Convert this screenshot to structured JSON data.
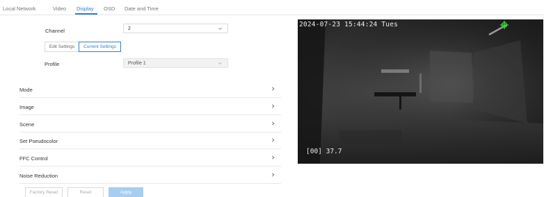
{
  "tabs": [
    {
      "label": "Local Network",
      "active": false
    },
    {
      "label": "Video",
      "active": false
    },
    {
      "label": "Display",
      "active": true
    },
    {
      "label": "OSD",
      "active": false
    },
    {
      "label": "Date and Time",
      "active": false
    }
  ],
  "channel": {
    "label": "Channel",
    "value": "2"
  },
  "settings_toggle": {
    "edit_label": "Edit Settings",
    "current_label": "Current Settings",
    "selected": "Current Settings"
  },
  "profile": {
    "label": "Profile",
    "value": "Profile 1",
    "disabled": true
  },
  "sections": [
    {
      "label": "Mode"
    },
    {
      "label": "Image"
    },
    {
      "label": "Scene"
    },
    {
      "label": "Set Pseudocolor"
    },
    {
      "label": "FFC Control"
    },
    {
      "label": "Noise Reduction"
    }
  ],
  "actions": {
    "factory_reset": "Factory Reset",
    "reset": "Reset",
    "apply": "Apply"
  },
  "preview": {
    "timestamp": "2024-07-23 15:44:24 Tues",
    "temperature": "[00] 37.7"
  },
  "colors": {
    "accent": "#2b7fd4",
    "apply_disabled": "#a9ccf1",
    "crosshair": "#3dcc3d"
  },
  "icons": {
    "select_chevron": "chevron-down-icon",
    "row_chevron": "chevron-right-icon",
    "crosshair": "crosshair-icon"
  }
}
